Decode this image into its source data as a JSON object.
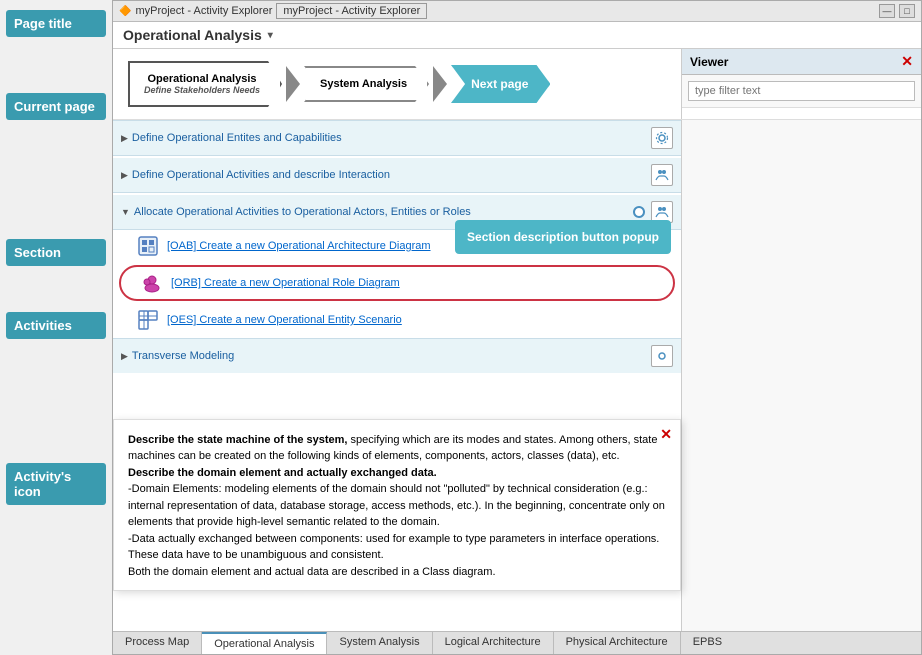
{
  "annotation_panel": {
    "page_title_label": "Page title",
    "current_page_label": "Current page",
    "section_label": "Section",
    "activities_label": "Activities",
    "activity_icon_label": "Activity's icon",
    "section_desc_label": "Section description button popup",
    "next_page_label": "Next page"
  },
  "title_bar": {
    "text": "myProject - Activity Explorer",
    "tab_label": "myProject - Activity Explorer"
  },
  "page_heading": {
    "title": "Operational Analysis"
  },
  "process_flow": {
    "steps": [
      {
        "label": "Operational Analysis",
        "subtitle": "Define Stakeholders Needs",
        "active": true
      },
      {
        "label": "System Analysis",
        "active": false
      },
      {
        "label": "Next page",
        "active": false,
        "highlight": true
      }
    ]
  },
  "sections": [
    {
      "id": "s1",
      "label": "Define Operational Entites and Capabilities",
      "expanded": false
    },
    {
      "id": "s2",
      "label": "Define Operational Activities and describe Interaction",
      "expanded": false
    },
    {
      "id": "s3",
      "label": "Allocate Operational Activities to Operational Actors, Entities or Roles",
      "expanded": true,
      "activities": [
        {
          "id": "a1",
          "label": "[OAB] Create a new Operational Architecture Diagram",
          "icon": "oab"
        },
        {
          "id": "a2",
          "label": "[ORB] Create a new Operational Role Diagram",
          "icon": "orb",
          "highlighted": true
        },
        {
          "id": "a3",
          "label": "[OES] Create a new Operational Entity Scenario",
          "icon": "oes"
        }
      ]
    }
  ],
  "transverse": {
    "label": "Transverse Modeling"
  },
  "viewer": {
    "title": "Viewer",
    "filter_placeholder": "type filter text"
  },
  "description_popup": {
    "para1_bold": "Describe the state machine of the system,",
    "para1_rest": " specifying which are its modes and states. Among others, state machines can be created on the following kinds of elements, components, actors, classes (data), etc.",
    "para2_bold": "Describe the domain element and actually exchanged data.",
    "para3": "-Domain Elements: modeling elements of the domain should not \"polluted\" by technical consideration (e.g.: internal representation of data, database storage, access methods, etc.). In the beginning, concentrate only on elements that provide high-level semantic related to the domain.\n-Data actually exchanged between components: used for example to type parameters in interface operations. These data have to be unambiguous and consistent.",
    "para4": "Both the domain element and actual data are described in a Class diagram."
  },
  "bottom_tabs": [
    {
      "label": "Process Map",
      "active": false
    },
    {
      "label": "Operational Analysis",
      "active": true
    },
    {
      "label": "System Analysis",
      "active": false
    },
    {
      "label": "Logical Architecture",
      "active": false
    },
    {
      "label": "Physical Architecture",
      "active": false
    },
    {
      "label": "EPBS",
      "active": false
    }
  ],
  "colors": {
    "annotation_bg": "#3a9baf",
    "accent_blue": "#4db6c7",
    "link_color": "#0066cc",
    "section_bg": "#e8f4f8",
    "highlight_border": "#cc3344"
  }
}
